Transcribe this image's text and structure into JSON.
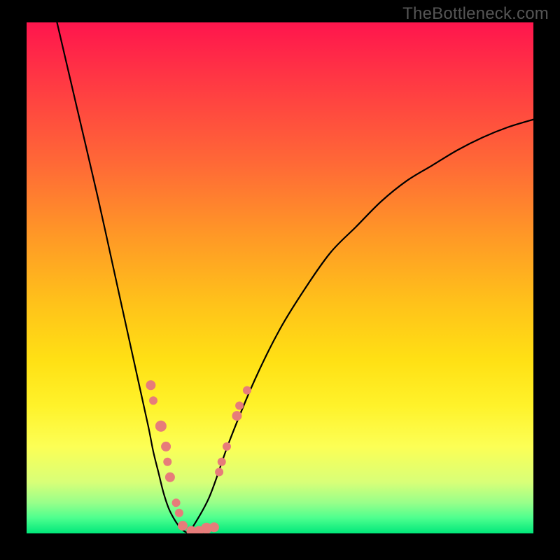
{
  "watermark": "TheBottleneck.com",
  "colors": {
    "dot": "#e77c7a",
    "curve": "#000000",
    "frame": "#000000"
  },
  "chart_data": {
    "type": "line",
    "title": "",
    "xlabel": "",
    "ylabel": "",
    "xlim": [
      0,
      100
    ],
    "ylim": [
      0,
      100
    ],
    "grid": false,
    "legend": false,
    "series": [
      {
        "name": "left-curve",
        "x": [
          6,
          10,
          14,
          18,
          20,
          22,
          24,
          25,
          26,
          27,
          28,
          29,
          30,
          31,
          32
        ],
        "y": [
          100,
          83,
          66,
          48,
          39,
          30,
          21,
          16,
          12,
          8,
          5,
          3,
          1.5,
          0.5,
          0
        ]
      },
      {
        "name": "right-curve",
        "x": [
          32,
          36,
          40,
          45,
          50,
          55,
          60,
          65,
          70,
          75,
          80,
          85,
          90,
          95,
          100
        ],
        "y": [
          0,
          7,
          18,
          30,
          40,
          48,
          55,
          60,
          65,
          69,
          72,
          75,
          77.5,
          79.5,
          81
        ]
      }
    ],
    "scatter_points": [
      {
        "x": 24.5,
        "y": 29,
        "r": 7
      },
      {
        "x": 25.0,
        "y": 26,
        "r": 6
      },
      {
        "x": 26.5,
        "y": 21,
        "r": 8
      },
      {
        "x": 27.5,
        "y": 17,
        "r": 7
      },
      {
        "x": 27.8,
        "y": 14,
        "r": 6
      },
      {
        "x": 28.3,
        "y": 11,
        "r": 7
      },
      {
        "x": 29.5,
        "y": 6,
        "r": 6
      },
      {
        "x": 30.1,
        "y": 4,
        "r": 6
      },
      {
        "x": 30.8,
        "y": 1.5,
        "r": 7
      },
      {
        "x": 32.5,
        "y": 0.5,
        "r": 7
      },
      {
        "x": 34.0,
        "y": 0.5,
        "r": 7
      },
      {
        "x": 35.5,
        "y": 1.0,
        "r": 8
      },
      {
        "x": 37.0,
        "y": 1.2,
        "r": 7
      },
      {
        "x": 38.0,
        "y": 12,
        "r": 6
      },
      {
        "x": 38.5,
        "y": 14,
        "r": 6
      },
      {
        "x": 39.5,
        "y": 17,
        "r": 6
      },
      {
        "x": 41.5,
        "y": 23,
        "r": 7
      },
      {
        "x": 42.0,
        "y": 25,
        "r": 6
      },
      {
        "x": 43.5,
        "y": 28,
        "r": 6
      }
    ],
    "background_gradient": {
      "type": "vertical",
      "stops": [
        {
          "pos": 0.0,
          "color": "#ff154d"
        },
        {
          "pos": 0.28,
          "color": "#ff6a36"
        },
        {
          "pos": 0.55,
          "color": "#ffc21a"
        },
        {
          "pos": 0.83,
          "color": "#fcff55"
        },
        {
          "pos": 1.0,
          "color": "#00e77a"
        }
      ]
    }
  }
}
